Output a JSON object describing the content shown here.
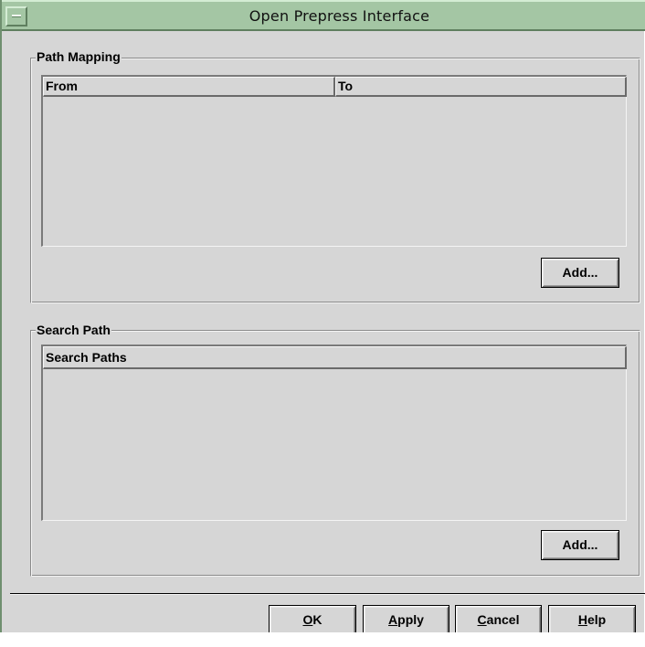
{
  "window": {
    "title": "Open Prepress Interface"
  },
  "path_mapping": {
    "group_title": "Path Mapping",
    "columns": [
      "From",
      "To"
    ],
    "rows": [],
    "add_label": "Add..."
  },
  "search_path": {
    "group_title": "Search Path",
    "columns": [
      "Search Paths"
    ],
    "rows": [],
    "add_label": "Add..."
  },
  "footer": {
    "ok": {
      "mnemonic": "O",
      "rest": "K"
    },
    "apply": {
      "mnemonic": "A",
      "rest": "pply"
    },
    "cancel": {
      "mnemonic": "C",
      "rest": "ancel"
    },
    "help": {
      "mnemonic": "H",
      "rest": "elp"
    }
  },
  "icons": {
    "window_menu": "window-menu-icon"
  },
  "colors": {
    "titlebar": "#a4c6a4",
    "dialog_bg": "#d6d6d6",
    "window_border": "#6f8f6f"
  }
}
